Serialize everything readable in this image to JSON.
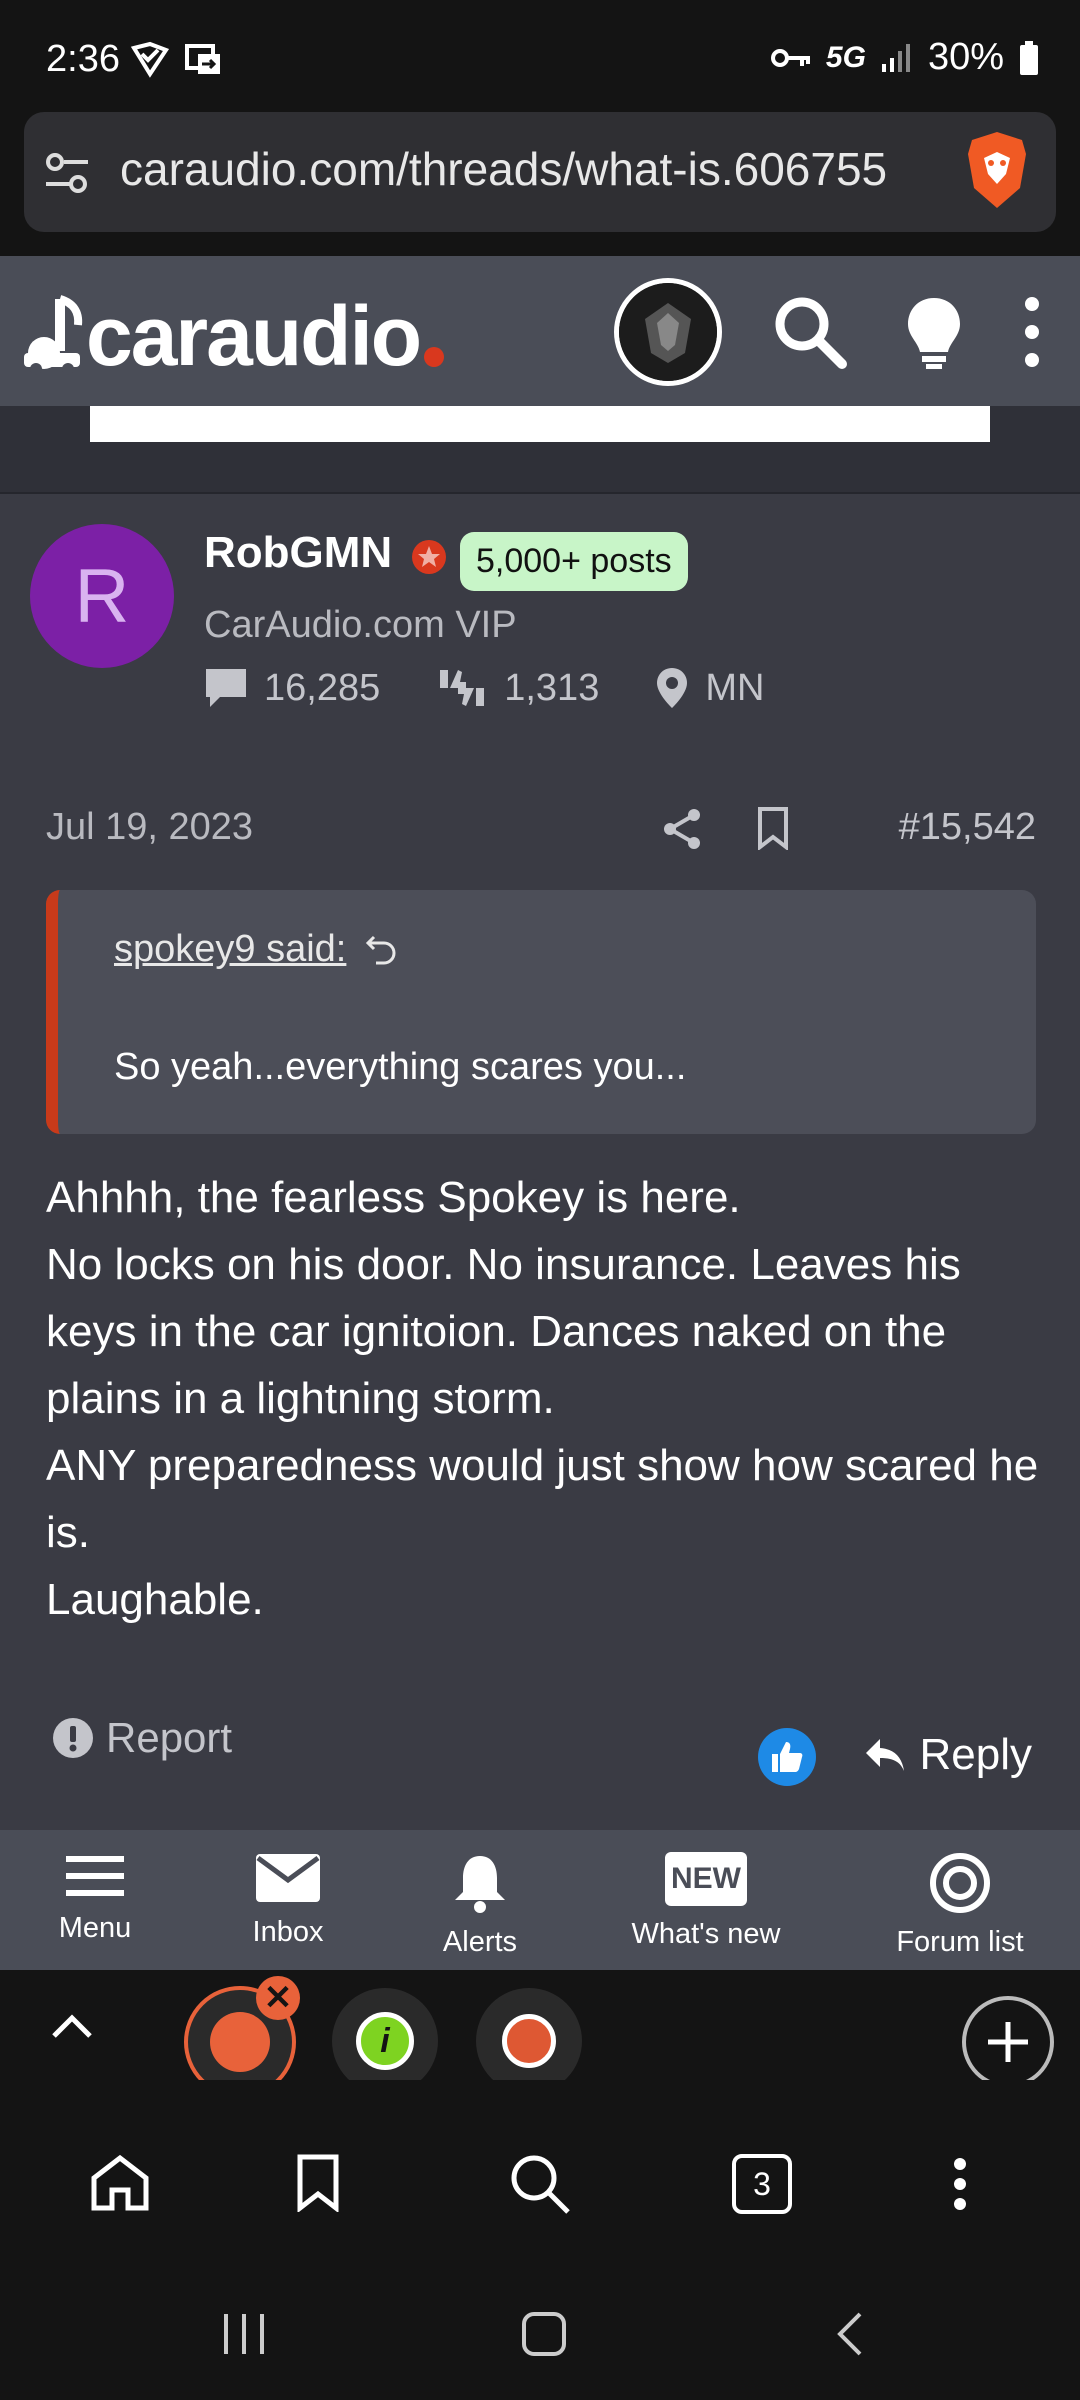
{
  "status_bar": {
    "time": "2:36",
    "network": "5G",
    "battery": "30%"
  },
  "browser": {
    "url": "caraudio.com/threads/what-is.606755",
    "open_tabs": "3"
  },
  "site": {
    "logo_text": "caraudio",
    "accent_color": "#d9381e"
  },
  "post": {
    "author": {
      "avatar_letter": "R",
      "name": "RobGMN",
      "badge": "5,000+ posts",
      "title": "CarAudio.com VIP",
      "messages": "16,285",
      "reactions": "1,313",
      "location": "MN"
    },
    "date": "Jul 19, 2023",
    "number": "#15,542",
    "quote": {
      "author": "spokey9 said:",
      "text": "So yeah...everything scares you..."
    },
    "body": [
      "Ahhhh, the fearless Spokey is here.",
      "No locks on his door. No insurance. Leaves his keys in the car ignitoion. Dances naked on the plains in a lightning storm.",
      "ANY preparedness would just show how scared he is.",
      "Laughable."
    ],
    "report_label": "Report",
    "reply_label": "Reply"
  },
  "forum_nav": {
    "menu": "Menu",
    "inbox": "Inbox",
    "alerts": "Alerts",
    "whats_new": "What's new",
    "whats_new_badge": "NEW",
    "forum_list": "Forum list"
  }
}
